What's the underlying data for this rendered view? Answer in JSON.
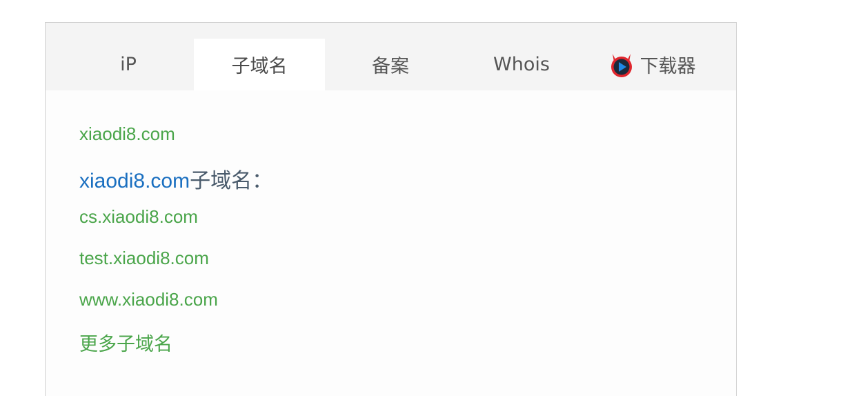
{
  "tabs": [
    {
      "label": "iP"
    },
    {
      "label": "子域名"
    },
    {
      "label": "备案"
    },
    {
      "label": "Whois"
    },
    {
      "label": "下载器",
      "icon": "devil-play-icon"
    }
  ],
  "active_tab": "子域名",
  "content": {
    "top_domain": "xiaodi8.com",
    "heading_domain": "xiaodi8.com",
    "heading_suffix": "子域名：",
    "subdomains": [
      "cs.xiaodi8.com",
      "test.xiaodi8.com",
      "www.xiaodi8.com"
    ],
    "more_label": "更多子域名"
  },
  "colors": {
    "link_green": "#4aa54a",
    "heading_blue": "#1a6fc0",
    "icon_red": "#e0262d",
    "icon_blue": "#1e88e5"
  }
}
